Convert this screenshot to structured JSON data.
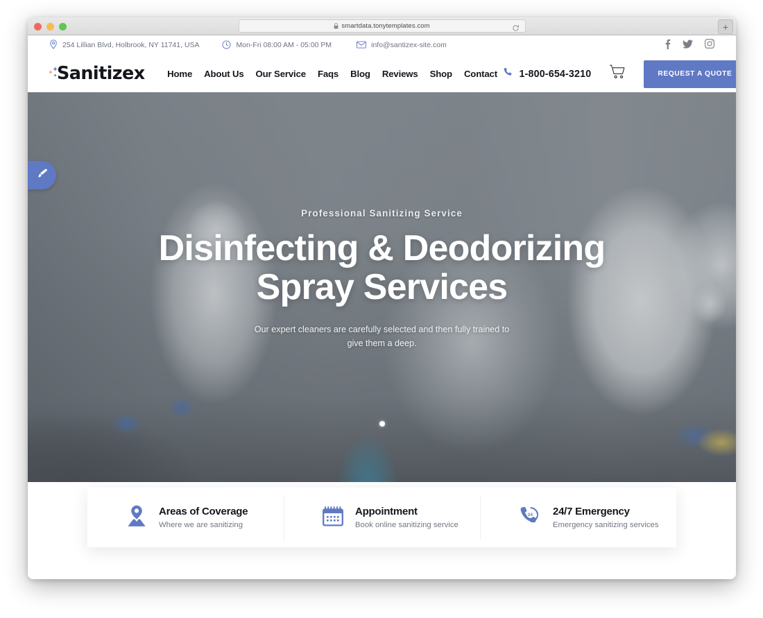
{
  "browser": {
    "url": "smartdata.tonytemplates.com",
    "lock_icon": "lock-icon",
    "reload_icon": "reload-icon",
    "new_tab_label": "+",
    "traffic_lights": [
      "close",
      "minimize",
      "zoom"
    ]
  },
  "topbar": {
    "address": "254 Lillian Blvd, Holbrook, NY 11741, USA",
    "hours": "Mon-Fri 08:00 AM - 05:00 PM",
    "email": "info@santizex-site.com",
    "social": [
      {
        "name": "facebook-icon",
        "label": "Facebook"
      },
      {
        "name": "twitter-icon",
        "label": "Twitter"
      },
      {
        "name": "instagram-icon",
        "label": "Instagram"
      }
    ]
  },
  "navbar": {
    "logo_text": "Sanitizex",
    "links": [
      {
        "label": "Home",
        "active": true
      },
      {
        "label": "About Us",
        "active": false
      },
      {
        "label": "Our Service",
        "active": false
      },
      {
        "label": "Faqs",
        "active": false
      },
      {
        "label": "Blog",
        "active": false
      },
      {
        "label": "Reviews",
        "active": false
      },
      {
        "label": "Shop",
        "active": false
      },
      {
        "label": "Contact",
        "active": false
      }
    ],
    "phone": "1-800-654-3210",
    "cart_icon": "shopping-cart-icon",
    "quote_button": "REQUEST A QUOTE",
    "quote_chevron": "›"
  },
  "hero": {
    "eyebrow": "Professional Sanitizing Service",
    "title_line1": "Disinfecting & Deodorizing",
    "title_line2": "Spray Services",
    "subtitle_line1": "Our expert cleaners are carefully selected and then fully trained to give",
    "subtitle_line2": "them a deep.",
    "slider_dots": 1,
    "edit_tab_icon": "paintbrush-icon"
  },
  "cards": [
    {
      "icon": "map-pin-icon",
      "title": "Areas of Coverage",
      "desc": "Where we are sanitizing"
    },
    {
      "icon": "calendar-icon",
      "title": "Appointment",
      "desc": "Book online sanitizing service"
    },
    {
      "icon": "phone-24-icon",
      "title": "24/7 Emergency",
      "desc": "Emergency sanitizing services"
    }
  ],
  "colors": {
    "accent": "#6079c4",
    "text_dark": "#14161c",
    "text_muted": "#707680",
    "white": "#ffffff"
  }
}
